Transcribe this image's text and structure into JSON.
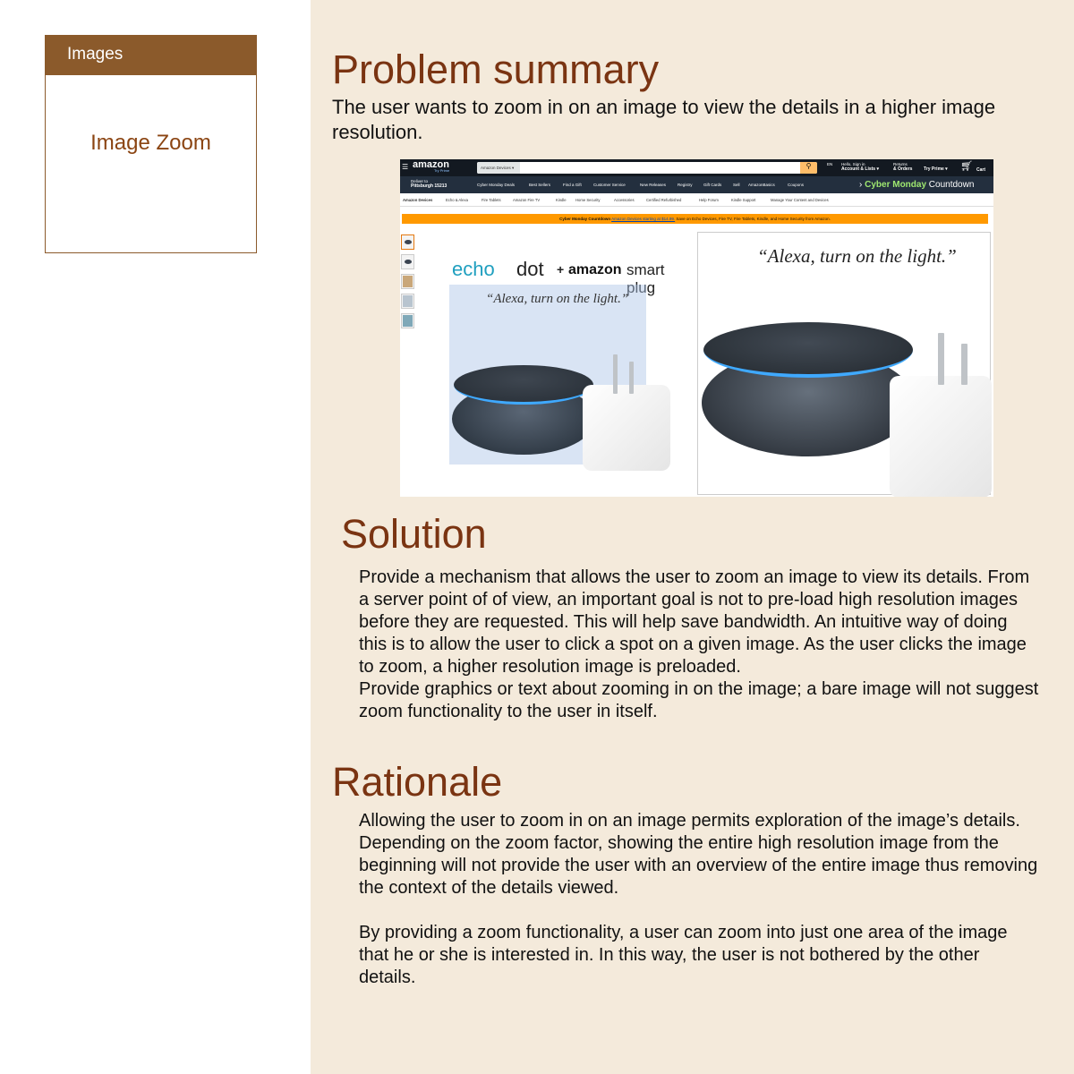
{
  "sidebar": {
    "section_title": "Images",
    "link_label": "Image Zoom"
  },
  "problem": {
    "heading": "Problem summary",
    "text": "The user wants to zoom in on an image to view the details in a higher image resolution."
  },
  "screenshot": {
    "amazon_logo": "amazon",
    "try_prime": "Try Prime",
    "search_category": "Amazon Devices ▾",
    "lang": "EN",
    "hello": "Hello, Sign in",
    "account": "Account & Lists ▾",
    "returns": "Returns",
    "orders": "& Orders",
    "try_prime_menu": "Try Prime ▾",
    "cart": "Cart",
    "deliver_to": "Deliver to",
    "location": "Pittsburgh 15213",
    "nav_links": [
      "Cyber Monday Deals",
      "Best Sellers",
      "Find a Gift",
      "Customer Service",
      "New Releases",
      "Registry",
      "Gift Cards",
      "Sell",
      "AmazonBasics",
      "Coupons"
    ],
    "countdown_bold": "Cyber Monday",
    "countdown_rest": "Countdown",
    "sub_nav": [
      "Amazon Devices",
      "Echo & Alexa",
      "Fire Tablets",
      "Amazon Fire TV",
      "Kindle",
      "Home Security",
      "Accessories",
      "Certified Refurbished",
      "Help Forum",
      "Kindle Support",
      "Manage Your Content and Devices"
    ],
    "banner_bold": "Cyber Monday Countdown",
    "banner_link": "Amazon Devices starting at $14.99.",
    "banner_rest": "Save on Echo Devices, Fire TV, Fire Tablets, Kindle, and Home Security from Amazon.",
    "product_echo": "echo",
    "product_dot": "dot",
    "product_plus": "+",
    "product_amazon": "amazon",
    "product_smart_plug": "smart plug",
    "quote": "“Alexa, turn on the light.”"
  },
  "solution": {
    "heading": "Solution",
    "text": "Provide a mechanism that allows the user to zoom an image to view its details. From a server point of of view, an important goal is not to pre-load high resolution images before they are requested. This will help save bandwidth. An intuitive way of doing this is to allow the user to click a spot on a given image. As the user clicks the image to zoom, a higher resolution image is preloaded.\nProvide graphics or text about zooming in on the image; a bare image will not suggest zoom functionality to the user in itself."
  },
  "rationale": {
    "heading": "Rationale",
    "text": "Allowing the user to zoom in on an image permits exploration of the image’s details. Depending on the zoom factor, showing the entire high resolution image from the beginning will not provide the user with an overview of the entire image thus removing the context of the details viewed.\n\nBy providing a zoom functionality, a user can zoom into just one area of the image that he or she is interested in. In this way, the user is not bothered by the other details."
  }
}
